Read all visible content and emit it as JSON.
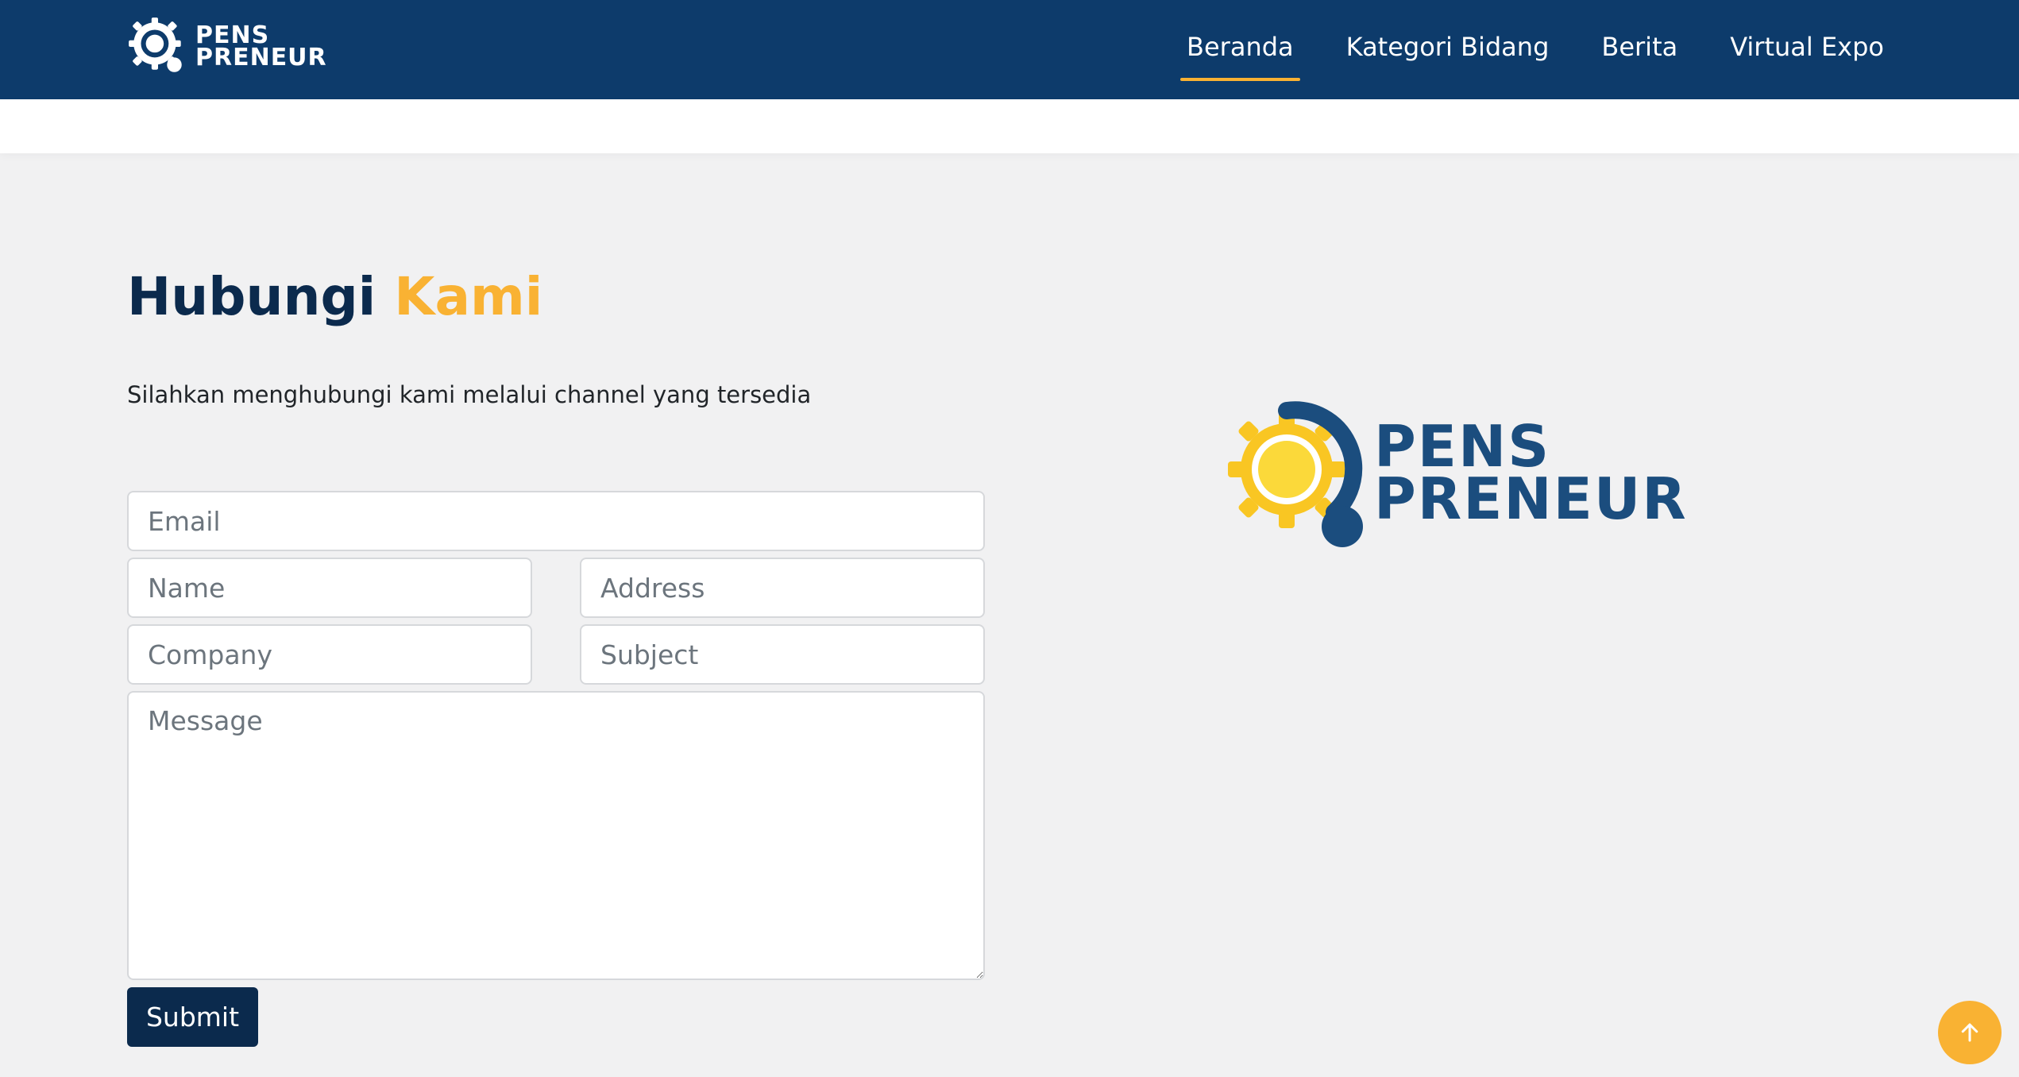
{
  "brand": {
    "line1": "PENS",
    "line2": "PRENEUR"
  },
  "nav": {
    "items": [
      {
        "label": "Beranda",
        "active": true
      },
      {
        "label": "Kategori Bidang",
        "active": false
      },
      {
        "label": "Berita",
        "active": false
      },
      {
        "label": "Virtual Expo",
        "active": false
      }
    ]
  },
  "contact": {
    "title_main": "Hubungi",
    "title_accent": "Kami",
    "subtitle": "Silahkan menghubungi kami melalui channel yang tersedia",
    "email_placeholder": "Email",
    "name_placeholder": "Name",
    "address_placeholder": "Address",
    "company_placeholder": "Company",
    "subject_placeholder": "Subject",
    "message_placeholder": "Message",
    "submit_label": "Submit"
  },
  "logo": {
    "line1": "PENS",
    "line2": "PRENEUR"
  },
  "colors": {
    "navbar": "#0d3b6b",
    "accent": "#f9b233",
    "title_dark": "#0b2a4d",
    "button": "#0b2a4d",
    "background": "#f1f1f2"
  },
  "icons": {
    "brand": "gear-magnifier-logo-icon",
    "scroll_top": "arrow-up-icon"
  }
}
